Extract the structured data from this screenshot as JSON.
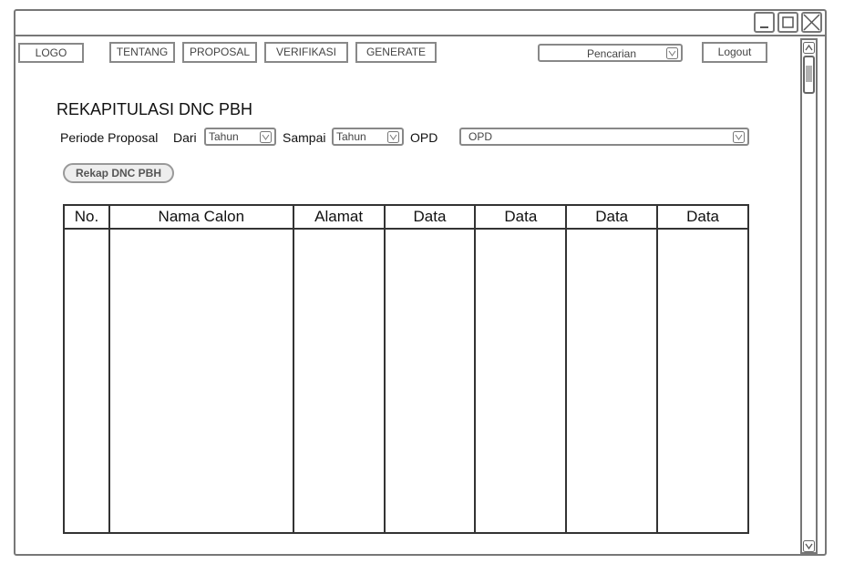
{
  "nav": {
    "logo": "LOGO",
    "items": [
      "TENTANG",
      "PROPOSAL",
      "VERIFIKASI",
      "GENERATE"
    ],
    "search_label": "Pencarian",
    "logout": "Logout"
  },
  "page": {
    "title": "REKAPITULASI DNC PBH",
    "period_label": "Periode Proposal",
    "from_label": "Dari",
    "from_value": "Tahun",
    "to_label": "Sampai",
    "to_value": "Tahun",
    "opd_label": "OPD",
    "opd_value": "OPD",
    "rekap_button": "Rekap DNC PBH"
  },
  "table": {
    "columns": [
      "No.",
      "Nama Calon",
      "Alamat",
      "Data",
      "Data",
      "Data",
      "Data"
    ]
  }
}
